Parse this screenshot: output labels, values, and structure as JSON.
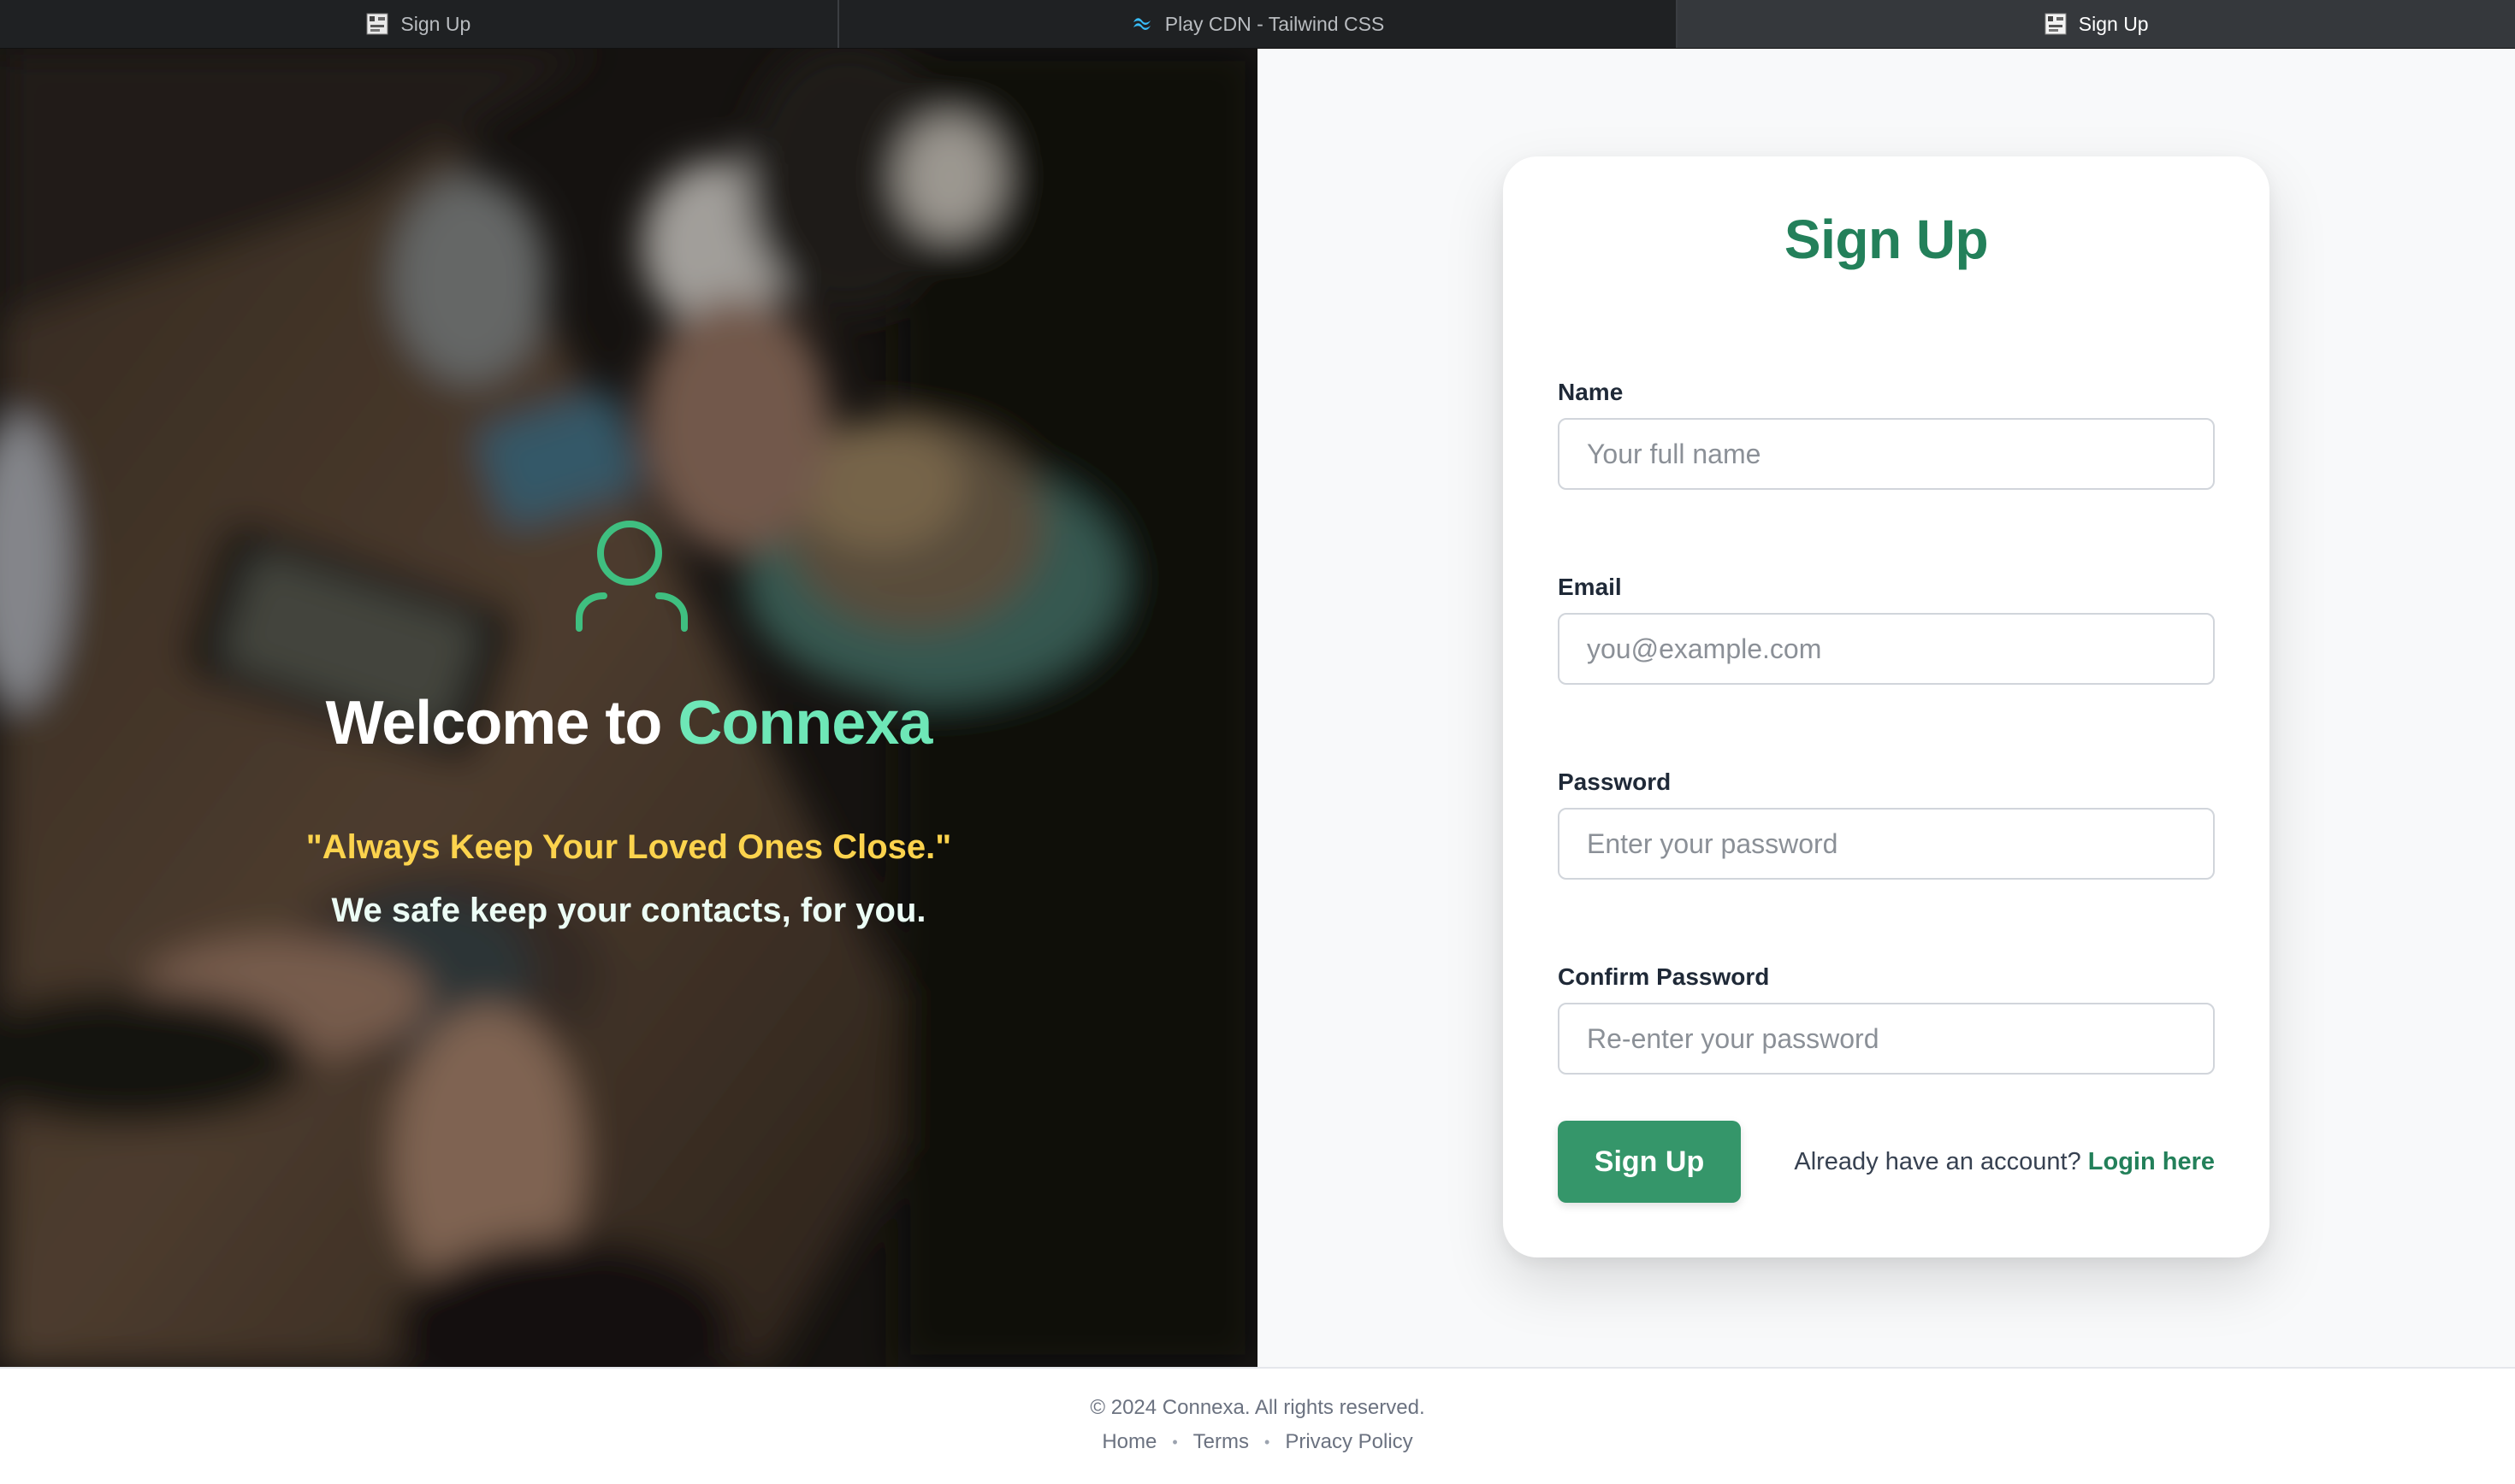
{
  "tabs": [
    {
      "label": "Sign Up",
      "icon": "page-favicon-icon",
      "active": false
    },
    {
      "label": "Play CDN - Tailwind CSS",
      "icon": "tailwind-icon",
      "active": false
    },
    {
      "label": "Sign Up",
      "icon": "page-favicon-icon",
      "active": true
    }
  ],
  "hero": {
    "icon": "user-icon",
    "title_prefix": "Welcome to ",
    "title_brand": "Connexa",
    "quote": "\"Always Keep Your Loved Ones Close.\"",
    "subtitle": "We safe keep your contacts, for you."
  },
  "form": {
    "title": "Sign Up",
    "fields": [
      {
        "label": "Name",
        "placeholder": "Your full name",
        "value": ""
      },
      {
        "label": "Email",
        "placeholder": "you@example.com",
        "value": ""
      },
      {
        "label": "Password",
        "placeholder": "Enter your password",
        "value": ""
      },
      {
        "label": "Confirm Password",
        "placeholder": "Re-enter your password",
        "value": ""
      }
    ],
    "submit_label": "Sign Up",
    "login_prompt": "Already have an account?",
    "login_link": "Login here"
  },
  "footer": {
    "copyright": "© 2024 Connexa. All rights reserved.",
    "links": [
      "Home",
      "Terms",
      "Privacy Policy"
    ],
    "separator": "•"
  },
  "colors": {
    "brand_green": "#23805a",
    "button_green": "#35966a",
    "hero_accent": "#6ee7b7",
    "quote_yellow": "#fcd34d"
  }
}
